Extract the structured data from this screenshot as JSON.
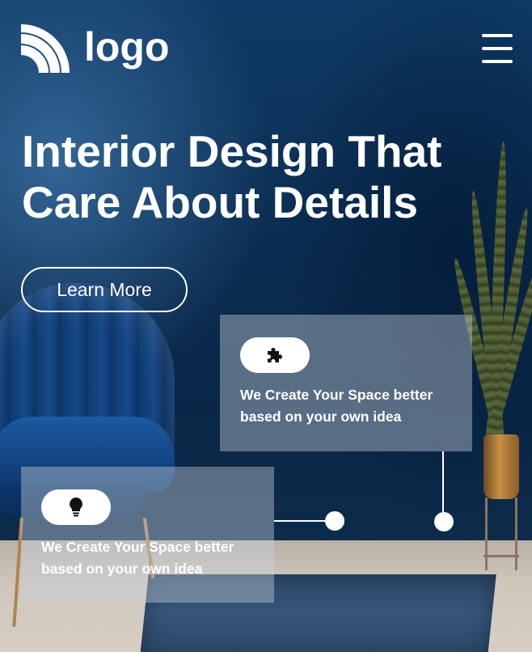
{
  "header": {
    "logo_text": "logo",
    "logo_icon": "signal-arcs-icon",
    "menu_icon": "hamburger-menu-icon"
  },
  "hero": {
    "headline_line1": "Interior Design That",
    "headline_line2": "Care About Details",
    "cta_label": "Learn More"
  },
  "features": [
    {
      "icon": "puzzle-piece-icon",
      "text_line1": "We Create Your Space better",
      "text_line2": "based on your own idea"
    },
    {
      "icon": "lightbulb-icon",
      "text_line1": "We Create Your Space better",
      "text_line2": "based on your own idea"
    }
  ],
  "colors": {
    "background": "#0b2c50",
    "text": "#ffffff",
    "card": "#c8d2dc"
  }
}
